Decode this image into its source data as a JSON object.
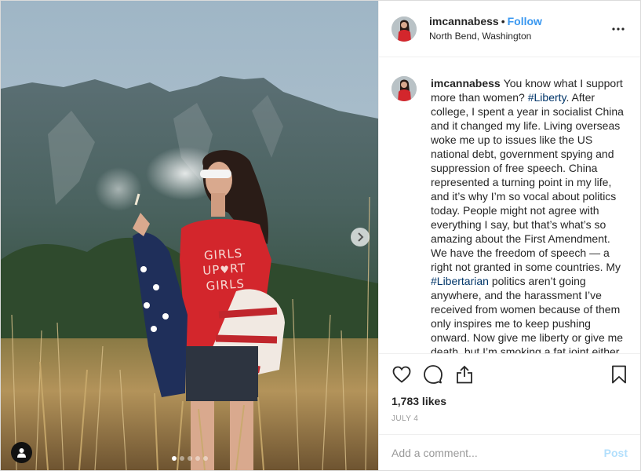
{
  "post": {
    "username": "imcannabess",
    "bullet": "•",
    "follow_label": "Follow",
    "location": "North Bend, Washington",
    "more_icon": "more-options-icon",
    "photo": {
      "description_icons": [
        "chevron-right-icon",
        "user-tag-icon"
      ],
      "slide_count": 5,
      "active_slide": 1,
      "shirt_text_line1": "GIRLS",
      "shirt_text_line2a": "UP",
      "shirt_text_line2b": "RT",
      "shirt_text_line3": "GIRLS"
    },
    "caption": {
      "username": "imcannabess",
      "part1": "You know what I support more than women? ",
      "tag1": "#Liberty",
      "part2": ". After college, I spent a year in socialist China and it changed my life. Living overseas woke me up to issues like the US national debt, government spying and suppression of free speech. China represented a turning point in my life, and it’s why I’m so vocal about politics today. People might not agree with everything I say, but that’s what’s so amazing about the First Amendment. We have the freedom of speech — a right not granted in some countries. My ",
      "tag2": "#Libertarian",
      "part3": " politics aren’t going anywhere, and the harassment I’ve received from women because of them only inspires me to keep pushing onward. Now give me liberty or give me death, but I’m smoking a fat joint either"
    },
    "actions": {
      "like_icon": "heart-icon",
      "comment_icon": "comment-icon",
      "share_icon": "share-icon",
      "save_icon": "bookmark-icon"
    },
    "likes": "1,783 likes",
    "date": "JULY 4",
    "comment_placeholder": "Add a comment...",
    "post_label": "Post"
  },
  "colors": {
    "link_blue": "#3897f0",
    "hashtag": "#003569",
    "post_disabled": "#b2dffc",
    "border": "#efefef",
    "muted": "#999999"
  }
}
